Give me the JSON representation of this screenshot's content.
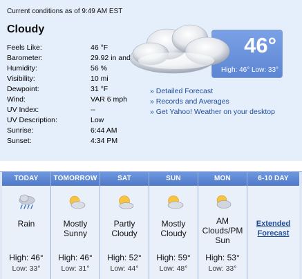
{
  "current": {
    "as_of": "Current conditions as of 9:49 AM EST",
    "condition": "Cloudy",
    "temperature": "46°",
    "high_low": "High: 46° Low: 33°",
    "details": [
      {
        "label": "Feels Like:",
        "value": "46 °F"
      },
      {
        "label": "Barometer:",
        "value": "29.92 in and rising"
      },
      {
        "label": "Humidity:",
        "value": "56 %"
      },
      {
        "label": "Visibility:",
        "value": "10 mi"
      },
      {
        "label": "Dewpoint:",
        "value": "31 °F"
      },
      {
        "label": "Wind:",
        "value": "VAR 6 mph"
      },
      {
        "label": "UV Index:",
        "value": "--"
      },
      {
        "label": "UV Description:",
        "value": "Low"
      },
      {
        "label": "Sunrise:",
        "value": "6:44 AM"
      },
      {
        "label": "Sunset:",
        "value": "4:34 PM"
      }
    ],
    "links": [
      "» Detailed Forecast",
      "» Records and Averages",
      "» Get Yahoo! Weather on your desktop"
    ]
  },
  "forecast": [
    {
      "day": "TODAY",
      "icon": "rain-cloud-icon",
      "desc": [
        "Rain"
      ],
      "high": "High: 46°",
      "low": "Low: 33°"
    },
    {
      "day": "TOMORROW",
      "icon": "sun-cloud-icon",
      "desc": [
        "Mostly",
        "Sunny"
      ],
      "high": "High: 46°",
      "low": "Low: 31°"
    },
    {
      "day": "SAT",
      "icon": "sun-cloud-icon",
      "desc": [
        "Partly",
        "Cloudy"
      ],
      "high": "High: 52°",
      "low": "Low: 44°"
    },
    {
      "day": "SUN",
      "icon": "sun-cloud-icon",
      "desc": [
        "Mostly",
        "Cloudy"
      ],
      "high": "High: 59°",
      "low": "Low: 48°"
    },
    {
      "day": "MON",
      "icon": "sun-cloud-icon",
      "desc": [
        "AM",
        "Clouds/PM",
        "Sun"
      ],
      "high": "High: 53°",
      "low": "Low: 33°"
    }
  ],
  "extended": {
    "day": "6-10 DAY",
    "link": [
      "Extended",
      "Forecast"
    ]
  },
  "colors": {
    "panel_bg": "#e5eefb",
    "header_blue": "#5b84d1",
    "link": "#1f4d9d"
  }
}
